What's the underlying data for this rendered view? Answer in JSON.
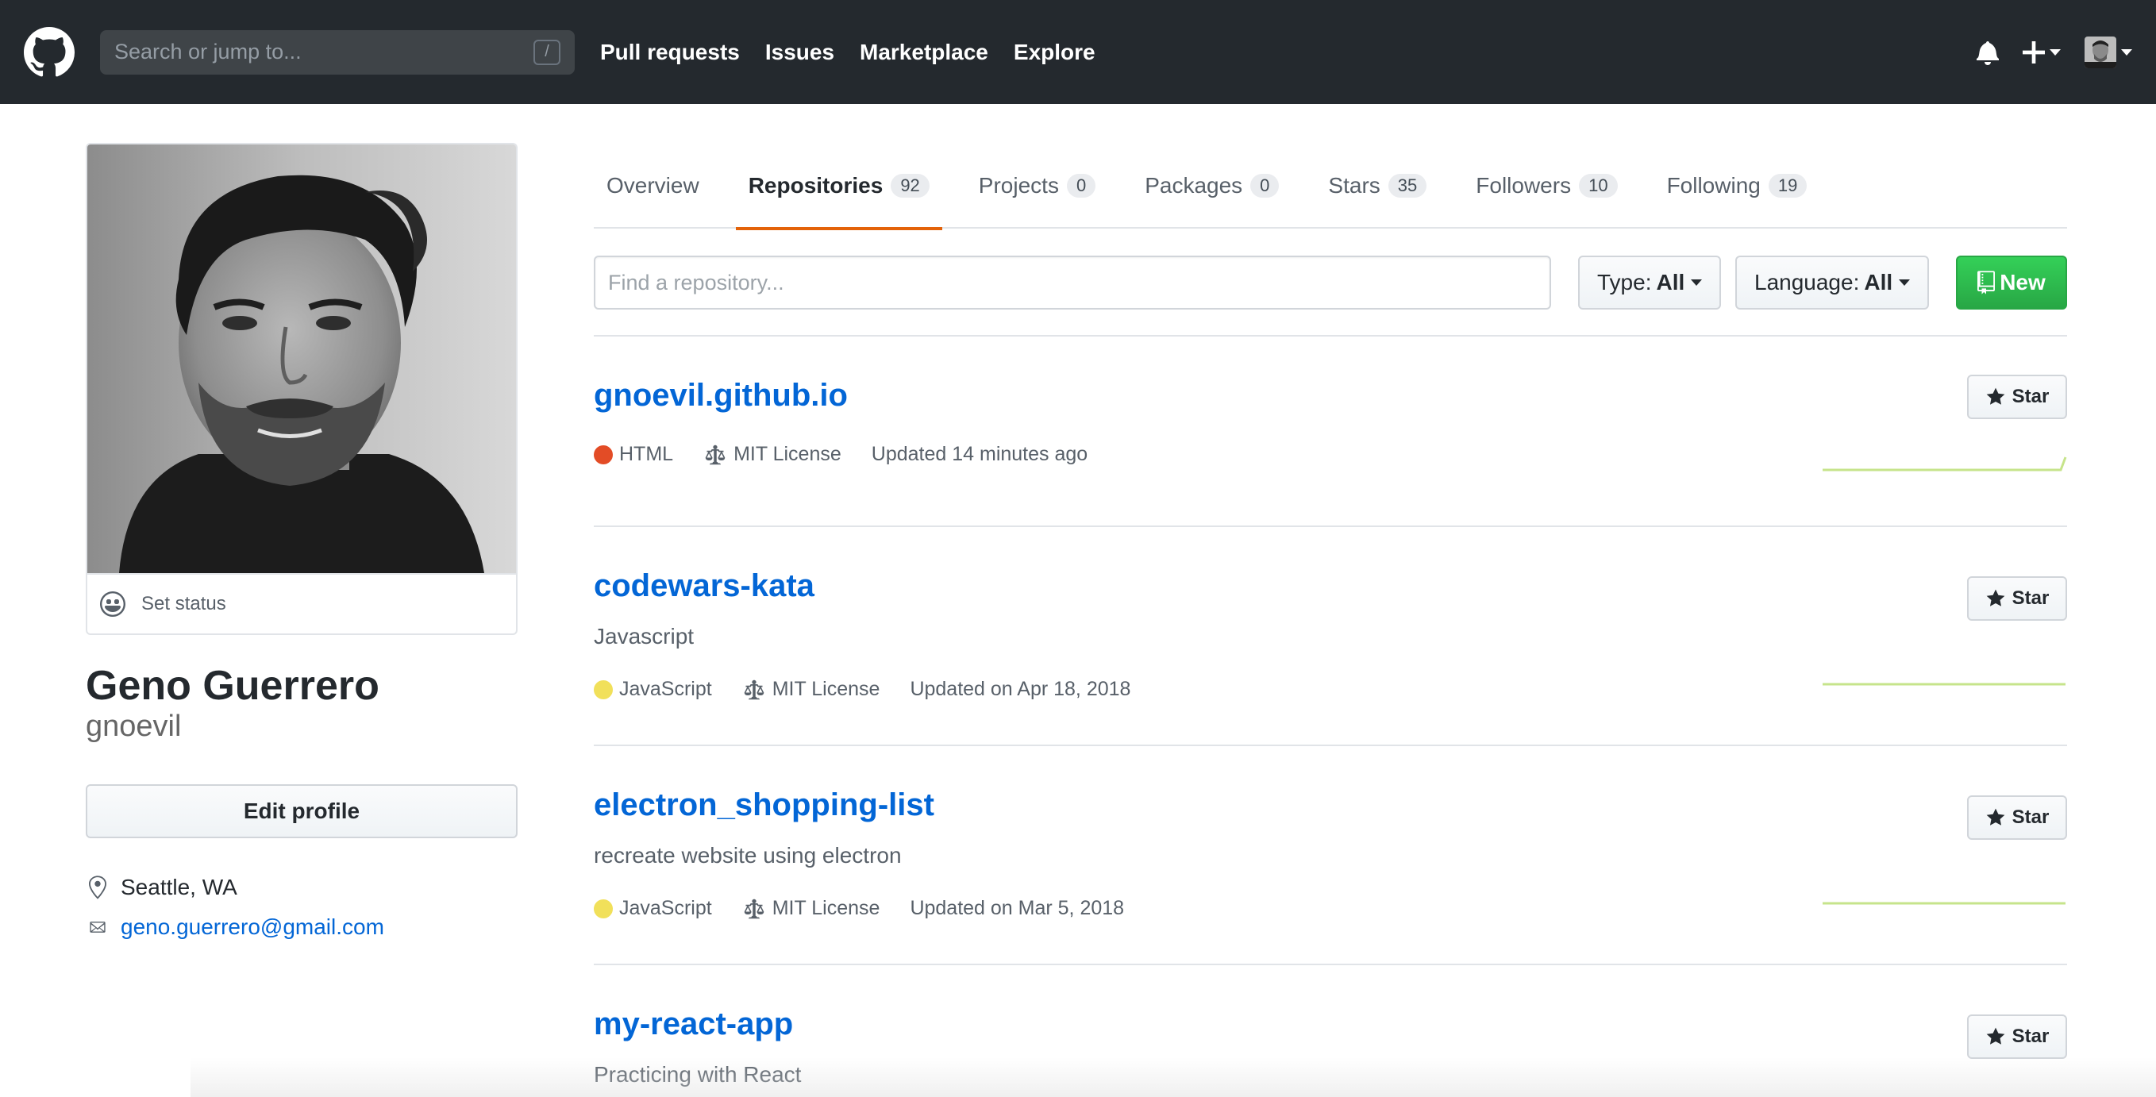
{
  "header": {
    "search_placeholder": "Search or jump to...",
    "search_shortcut": "/",
    "nav": [
      "Pull requests",
      "Issues",
      "Marketplace",
      "Explore"
    ]
  },
  "profile": {
    "set_status": "Set status",
    "fullname": "Geno Guerrero",
    "username": "gnoevil",
    "edit_profile": "Edit profile",
    "location": "Seattle, WA",
    "email": "geno.guerrero@gmail.com"
  },
  "tabs": [
    {
      "label": "Overview",
      "count": ""
    },
    {
      "label": "Repositories",
      "count": "92"
    },
    {
      "label": "Projects",
      "count": "0"
    },
    {
      "label": "Packages",
      "count": "0"
    },
    {
      "label": "Stars",
      "count": "35"
    },
    {
      "label": "Followers",
      "count": "10"
    },
    {
      "label": "Following",
      "count": "19"
    }
  ],
  "filters": {
    "find_placeholder": "Find a repository...",
    "type_label": "Type:",
    "type_value": "All",
    "language_label": "Language:",
    "language_value": "All",
    "new_label": "New"
  },
  "repos": [
    {
      "name": "gnoevil.github.io",
      "description": "",
      "language": "HTML",
      "lang_color": "#e34c26",
      "license": "MIT License",
      "updated": "Updated 14 minutes ago",
      "star": "Star"
    },
    {
      "name": "codewars-kata",
      "description": "Javascript",
      "language": "JavaScript",
      "lang_color": "#f1e05a",
      "license": "MIT License",
      "updated": "Updated on Apr 18, 2018",
      "star": "Star"
    },
    {
      "name": "electron_shopping-list",
      "description": "recreate website using electron",
      "language": "JavaScript",
      "lang_color": "#f1e05a",
      "license": "MIT License",
      "updated": "Updated on Mar 5, 2018",
      "star": "Star"
    },
    {
      "name": "my-react-app",
      "description": "Practicing with React",
      "star": "Star"
    }
  ],
  "colors": {
    "header_bg": "#24292e",
    "link": "#0366d6",
    "active_tab": "#e36209",
    "new_button": "#28a745",
    "sparkline": "#c6e48b"
  }
}
